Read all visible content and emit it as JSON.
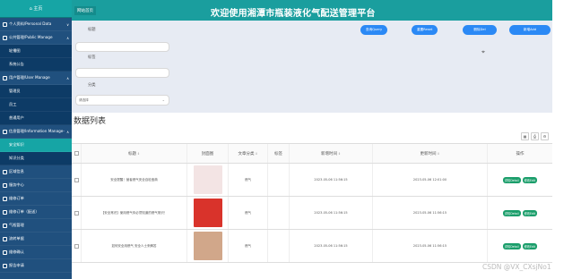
{
  "sidebar": {
    "home_label": "⌂ 主页",
    "items": [
      {
        "label": "个人资料/Personal Data",
        "chev": "∨"
      },
      {
        "label": "公共管理/Public Manage",
        "chev": "∧"
      },
      {
        "label": "轮播图",
        "sub": true
      },
      {
        "label": "系统公告",
        "sub": true
      },
      {
        "label": "用户管理/User Manage",
        "chev": "∧"
      },
      {
        "label": "管理员",
        "sub": true
      },
      {
        "label": "员工",
        "sub": true
      },
      {
        "label": "普通用户",
        "sub": true
      },
      {
        "label": "信息管理/Information Manage-",
        "chev": "∧"
      },
      {
        "label": "安全知识",
        "sub": true,
        "active": true
      },
      {
        "label": "知识分类",
        "sub": true
      },
      {
        "label": "区域信息"
      },
      {
        "label": "服务中心"
      },
      {
        "label": "维修订单"
      },
      {
        "label": "维修订单（配送）"
      },
      {
        "label": "气瓶管理"
      },
      {
        "label": "流转单据"
      },
      {
        "label": "维修确认"
      },
      {
        "label": "报告申请"
      }
    ]
  },
  "header": {
    "site_label": "网站首页",
    "title": "欢迎使用湘潭市瓶装液化气配送管理平台"
  },
  "filter": {
    "label_title": "标题",
    "label_tag": "标签",
    "label_category": "分类",
    "select_value": "请选择",
    "buttons": [
      "查询Query",
      "重置Reset",
      "删除Del",
      "新增Add"
    ]
  },
  "list_title": "数据列表",
  "toolbar_icons": [
    "grid-icon",
    "print-icon",
    "settings-icon"
  ],
  "table": {
    "headers": [
      "标题",
      "封面图",
      "文章分类",
      "标签",
      "新增时间",
      "更新时间",
      "操作"
    ],
    "rows": [
      {
        "title": "安全提醒！营者燃气安全自检宝典",
        "category": "燃气",
        "tag": "",
        "created": "2023-05-06 11:56:15",
        "updated": "2023-05-06 12:01:00",
        "thumb": "#f3e4e4"
      },
      {
        "title": "【安全常识】使用燃气你必须知道的燃气常识！",
        "category": "燃气",
        "tag": "",
        "created": "2023-05-06 11:56:15",
        "updated": "2023-05-06 11:56:15",
        "thumb": "#d9332b"
      },
      {
        "title": "如何安全用燃气 安全人士来解答",
        "category": "燃气",
        "tag": "",
        "created": "2023-05-06 11:56:15",
        "updated": "2023-05-06 11:56:15",
        "thumb": "#d1a78a"
      }
    ],
    "action_view": "详情Detail",
    "action_edit": "修改Edit"
  },
  "watermark": "CSDN @VX_CXsjNo1"
}
